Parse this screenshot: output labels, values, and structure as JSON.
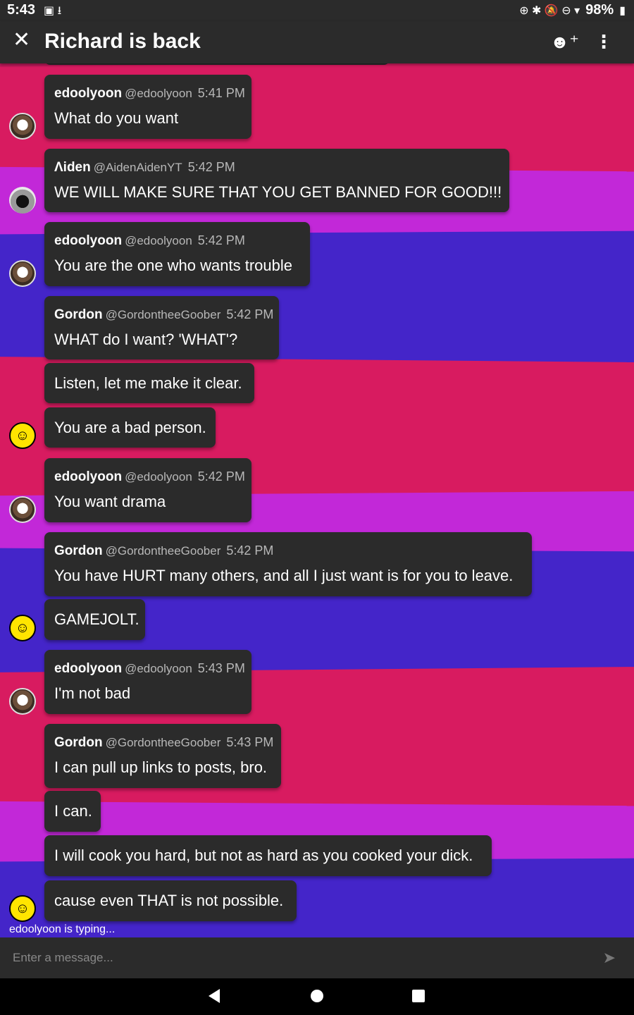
{
  "status_bar": {
    "time": "5:43",
    "left_icons": "▣ ⭳",
    "right_icons": "⊕ ✱ 🔕 ⊖ ▾",
    "battery": "98%"
  },
  "header": {
    "title": "Richard is back",
    "close_icon": "close-icon",
    "add_member_icon": "add-emoji-user-icon",
    "more_icon": "more-vert-icon"
  },
  "messages": [
    {
      "author": "edoolyoon",
      "handle": "@edoolyoon",
      "time": "5:41 PM",
      "text": "What do you want",
      "avatar": "ghost"
    },
    {
      "author": "Ʌiden",
      "handle": "@AidenAidenYT",
      "time": "5:42 PM",
      "text": "WE WILL MAKE SURE THAT YOU GET BANNED FOR GOOD!!!",
      "avatar": "aiden"
    },
    {
      "author": "edoolyoon",
      "handle": "@edoolyoon",
      "time": "5:42 PM",
      "text": "You are the one who wants trouble",
      "avatar": "ghost"
    },
    {
      "author": "Gordon",
      "handle": "@GordontheeGoober",
      "time": "5:42 PM",
      "text": "WHAT do I want? 'WHAT'?"
    },
    {
      "text": "Listen, let me make it clear."
    },
    {
      "text": "You are a bad person.",
      "avatar": "awesome"
    },
    {
      "author": "edoolyoon",
      "handle": "@edoolyoon",
      "time": "5:42 PM",
      "text": "You want drama",
      "avatar": "ghost"
    },
    {
      "author": "Gordon",
      "handle": "@GordontheeGoober",
      "time": "5:42 PM",
      "text": "You have HURT many others, and all I just want is for you to leave."
    },
    {
      "text": "GAMEJOLT.",
      "avatar": "awesome"
    },
    {
      "author": "edoolyoon",
      "handle": "@edoolyoon",
      "time": "5:43 PM",
      "text": "I'm not bad",
      "avatar": "ghost"
    },
    {
      "author": "Gordon",
      "handle": "@GordontheeGoober",
      "time": "5:43 PM",
      "text": "I can pull up links to posts, bro."
    },
    {
      "text": "I can."
    },
    {
      "text": "I will cook you hard, but not as hard as you cooked your dick."
    },
    {
      "text": "cause even THAT is not possible.",
      "avatar": "awesome"
    }
  ],
  "typing_indicator": "edoolyoon is typing...",
  "composer": {
    "placeholder": "Enter a message...",
    "send_icon": "send-icon"
  },
  "colors": {
    "bar_bg": "#2b2b2b",
    "stripe_pink": "#d81b60",
    "stripe_magenta": "#c228d8",
    "stripe_blue": "#4425c9"
  }
}
